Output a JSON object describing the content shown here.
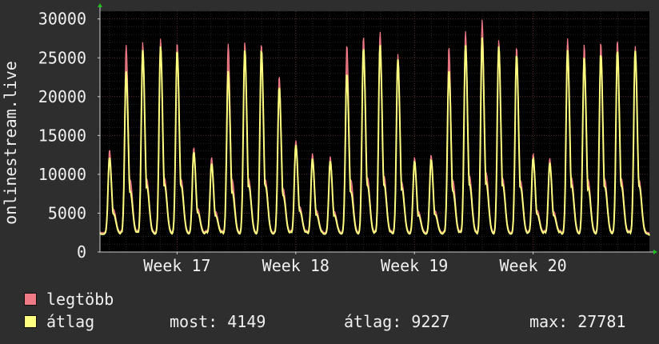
{
  "chart_data": {
    "type": "line",
    "ylabel": "onlinestream.live",
    "ylim": [
      0,
      31000
    ],
    "yticks": [
      0,
      5000,
      10000,
      15000,
      20000,
      25000,
      30000
    ],
    "xlim": [
      16.35,
      20.98
    ],
    "xticks": [
      {
        "x": 17,
        "label": "Week 17"
      },
      {
        "x": 18,
        "label": "Week 18"
      },
      {
        "x": 19,
        "label": "Week 19"
      },
      {
        "x": 20,
        "label": "Week 20"
      }
    ],
    "grid": true,
    "colors": {
      "background": "#000000",
      "grid": "#5a2a2a",
      "axis": "#cccccc",
      "max_series": "#f07a85",
      "avg_series": "#ffff80"
    },
    "daily_peaks": {
      "x": [
        16.43,
        16.57,
        16.71,
        16.86,
        17.0,
        17.14,
        17.29,
        17.43,
        17.57,
        17.71,
        17.86,
        18.0,
        18.14,
        18.29,
        18.43,
        18.57,
        18.71,
        18.86,
        19.0,
        19.14,
        19.29,
        19.43,
        19.57,
        19.71,
        19.86,
        20.0,
        20.14,
        20.29,
        20.43,
        20.57,
        20.71,
        20.86
      ],
      "legtobb": [
        13200,
        26700,
        27000,
        27500,
        27000,
        13500,
        12200,
        26800,
        27000,
        26800,
        22700,
        14400,
        12700,
        12300,
        26700,
        27800,
        28400,
        25500,
        12200,
        12500,
        26500,
        28500,
        29900,
        27300,
        26400,
        12700,
        12100,
        27500,
        26700,
        27000,
        27300,
        26600
      ],
      "atlag": [
        12200,
        23300,
        26000,
        26500,
        26000,
        12900,
        11400,
        23300,
        26000,
        26000,
        21300,
        13800,
        12000,
        11700,
        23000,
        26300,
        26700,
        24800,
        11700,
        11900,
        23500,
        26700,
        27600,
        26500,
        25400,
        12100,
        11500,
        26000,
        25000,
        25500,
        26000,
        26000
      ]
    },
    "series": [
      {
        "name": "legtöbb",
        "color": "#f07a85"
      },
      {
        "name": "átlag",
        "color": "#ffff80"
      }
    ]
  },
  "stats": {
    "now_label": "most:",
    "now_value": "4149",
    "avg_label": "átlag:",
    "avg_value": "9227",
    "max_label": "max:",
    "max_value": "27781"
  }
}
